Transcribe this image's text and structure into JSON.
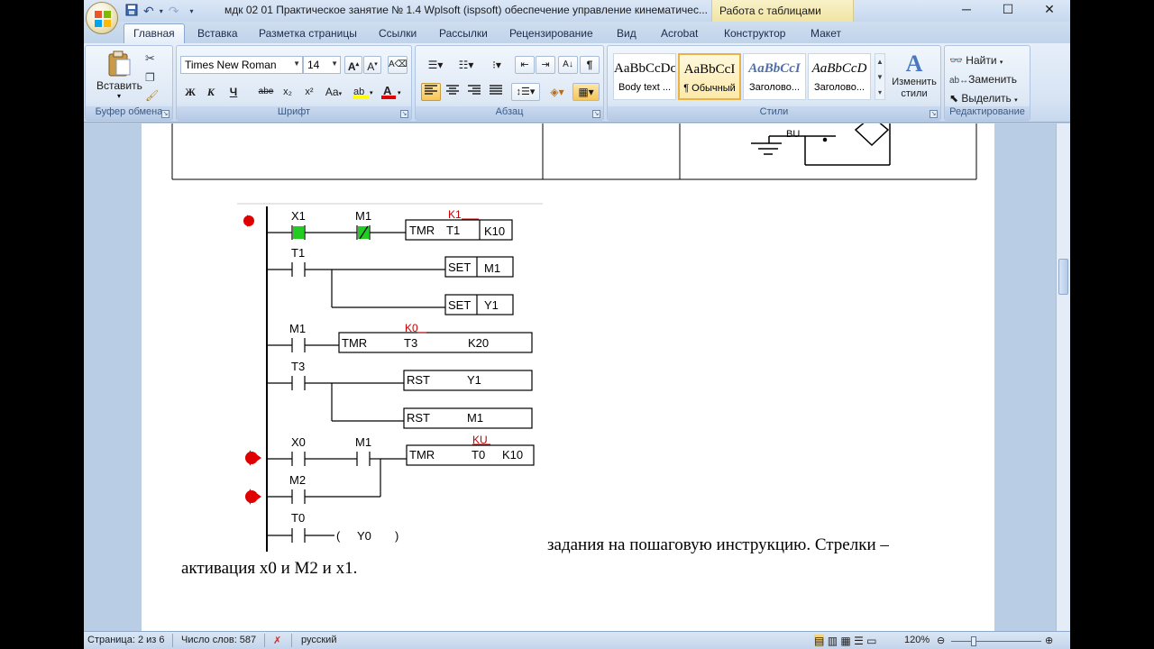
{
  "window": {
    "title": "мдк 02 01 Практическое занятие № 1.4 Wplsoft (ispsoft) обеспечение управление кинематичес...",
    "context_tab": "Работа с таблицами",
    "minimize": "─",
    "maximize": "☐",
    "close": "✕"
  },
  "tabs": [
    "Главная",
    "Вставка",
    "Разметка страницы",
    "Ссылки",
    "Рассылки",
    "Рецензирование",
    "Вид",
    "Acrobat",
    "Конструктор",
    "Макет"
  ],
  "ribbon": {
    "clipboard": {
      "paste_label": "Вставить",
      "group_label": "Буфер обмена"
    },
    "font": {
      "font_name": "Times New Roman",
      "font_size": "14",
      "group_label": "Шрифт",
      "bold": "Ж",
      "italic": "К",
      "underline": "Ч",
      "strike": "abe",
      "subscript": "x₂",
      "superscript": "x²",
      "change_case": "Aa"
    },
    "paragraph": {
      "group_label": "Абзац",
      "pilcrow": "¶"
    },
    "styles": {
      "group_label": "Стили",
      "items": [
        {
          "sample": "AaBbCcDc",
          "name": "Body text ..."
        },
        {
          "sample": "AaBbCcI",
          "name": "¶ Обычный"
        },
        {
          "sample": "AaBbCcI",
          "name": "Заголово..."
        },
        {
          "sample": "AaBbCcD",
          "name": "Заголово..."
        }
      ],
      "change_styles": "Изменить стили"
    },
    "editing": {
      "group_label": "Редактирование",
      "find": "Найти",
      "replace": "Заменить",
      "select": "Выделить"
    }
  },
  "document": {
    "table_cell_label": "BU",
    "ladder": {
      "rungs": [
        {
          "contacts": [
            "X1",
            "M1"
          ],
          "instruction": "TMR",
          "operand": "T1",
          "value": "K10",
          "note": "K1"
        },
        {
          "contacts": [
            "T1"
          ],
          "instruction": "SET",
          "operand": "M1"
        },
        {
          "instruction": "SET",
          "operand": "Y1"
        },
        {
          "contacts": [
            "M1"
          ],
          "instruction": "TMR",
          "operand": "T3",
          "value": "K20",
          "note": "K0"
        },
        {
          "contacts": [
            "T3"
          ],
          "instruction": "RST",
          "operand": "Y1"
        },
        {
          "instruction": "RST",
          "operand": "M1"
        },
        {
          "contacts": [
            "X0",
            "M1"
          ],
          "instruction": "TMR",
          "operand": "T0",
          "value": "K10",
          "note": "KU"
        },
        {
          "contacts": [
            "M2"
          ]
        },
        {
          "contacts": [
            "T0"
          ],
          "instruction": "(",
          "operand": "Y0",
          "value": ")"
        }
      ]
    },
    "text_line1": "задания на пошаговую инструкцию. Стрелки –",
    "text_line2": "активация  x0  и M2 и x1."
  },
  "status": {
    "page": "Страница: 2 из 6",
    "words": "Число слов: 587",
    "language": "русский",
    "zoom": "120%"
  },
  "colors": {
    "contact_green": "#22cc22",
    "arrow_red": "#e00000",
    "note_red": "#cc0000"
  }
}
